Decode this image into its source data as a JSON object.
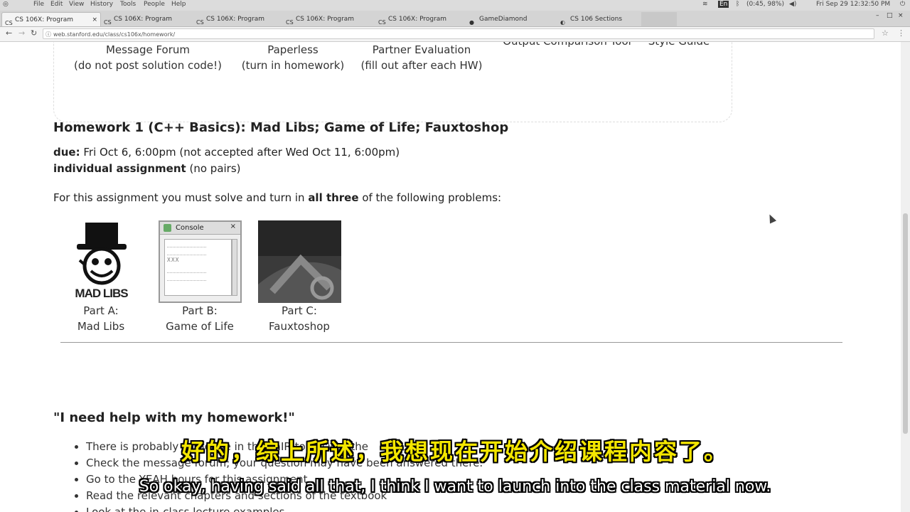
{
  "menubar": {
    "items": [
      "File",
      "Edit",
      "View",
      "History",
      "Tools",
      "People",
      "Help"
    ],
    "clock": "Fri Sep 29 12:32:50 PM",
    "battery": "(0:45, 98%)",
    "lang": "En"
  },
  "tabs": [
    {
      "label": "CS 106X: Program",
      "active": true
    },
    {
      "label": "CS 106X: Program",
      "active": false
    },
    {
      "label": "CS 106X: Program",
      "active": false
    },
    {
      "label": "CS 106X: Program",
      "active": false
    },
    {
      "label": "CS 106X: Program",
      "active": false
    },
    {
      "label": "GameDiamond",
      "active": false
    },
    {
      "label": "CS 106 Sections",
      "active": false
    }
  ],
  "address": "web.stanford.edu/class/cs106x/homework/",
  "links": [
    {
      "line1": "Message Forum",
      "line2": "(do not post solution code!)"
    },
    {
      "line1": "Paperless",
      "line2": "(turn in homework)"
    },
    {
      "line1": "Partner Evaluation",
      "line2": "(fill out after each HW)"
    },
    {
      "line1": "Output Comparison Tool",
      "line2": ""
    },
    {
      "line1": "Style Guide",
      "line2": ""
    }
  ],
  "homework": {
    "title": "Homework 1 (C++ Basics): Mad Libs; Game of Life; Fauxtoshop",
    "due_label": "due:",
    "due_text": " Fri Oct 6, 6:00pm (not accepted after Wed Oct 11, 6:00pm)",
    "individual_label": "individual assignment",
    "individual_text": " (no pairs)",
    "intro_before": "For this assignment you must solve and turn in ",
    "intro_bold": "all three",
    "intro_after": " of the following problems:",
    "parts": [
      {
        "line1": "Part A:",
        "line2": "Mad Libs"
      },
      {
        "line1": "Part B:",
        "line2": "Game of Life"
      },
      {
        "line1": "Part C:",
        "line2": "Fauxtoshop"
      }
    ],
    "madlibs_logo": "MAD LIBS",
    "console_title": "Console",
    "console_mid": "XXX"
  },
  "help": {
    "title": "\"I need help with my homework!\"",
    "items": [
      "There is probably someone in the LaIR to answer the",
      "Check the message forum; your question may have been answered there.",
      "Go to the YEAH hours for this assignment.",
      "Read the relevant chapters and sections of the textbook",
      "Look at the in-class lecture examples"
    ]
  },
  "subtitles": {
    "zh": "好的，综上所述，我想现在开始介绍课程内容了。",
    "en": "So okay, having said all that, I think I want to launch into the class material now."
  }
}
